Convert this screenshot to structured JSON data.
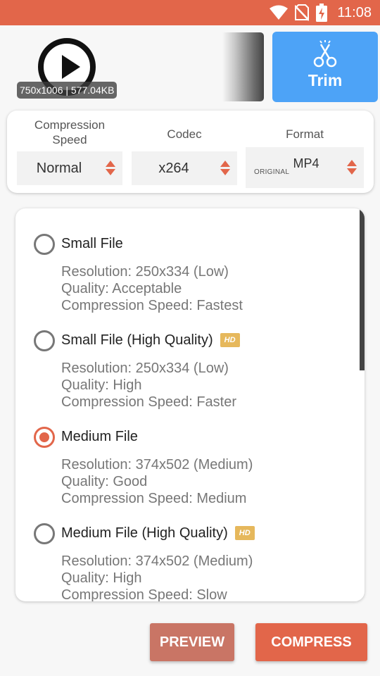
{
  "status_bar": {
    "time": "11:08",
    "icons": [
      "wifi-icon",
      "no-sim-icon",
      "battery-charging-icon"
    ],
    "color": "#e2664a"
  },
  "video": {
    "info": "750x1006 | 577.04KB",
    "icon": "play-icon"
  },
  "trim": {
    "label": "Trim",
    "icon": "scissors-icon",
    "color": "#4da3f7"
  },
  "settings": {
    "compression_speed": {
      "header": "Compression Speed",
      "value": "Normal"
    },
    "codec": {
      "header": "Codec",
      "value": "x264"
    },
    "format": {
      "header": "Format",
      "tag": "ORIGINAL",
      "value": "MP4"
    }
  },
  "options": [
    {
      "title": "Small File",
      "hd": false,
      "selected": false,
      "resolution": "Resolution: 250x334 (Low)",
      "quality": "Quality: Acceptable",
      "speed": "Compression Speed: Fastest"
    },
    {
      "title": "Small File (High Quality)",
      "hd": true,
      "hd_label": "HD",
      "selected": false,
      "resolution": "Resolution: 250x334 (Low)",
      "quality": "Quality: High",
      "speed": "Compression Speed: Faster"
    },
    {
      "title": "Medium File",
      "hd": false,
      "selected": true,
      "resolution": "Resolution: 374x502 (Medium)",
      "quality": "Quality: Good",
      "speed": "Compression Speed: Medium"
    },
    {
      "title": "Medium File (High Quality)",
      "hd": true,
      "hd_label": "HD",
      "selected": false,
      "resolution": "Resolution: 374x502 (Medium)",
      "quality": "Quality: High",
      "speed": "Compression Speed: Slow"
    }
  ],
  "actions": {
    "preview_label": "PREVIEW",
    "compress_label": "COMPRESS",
    "accent_color": "#e2664a"
  }
}
